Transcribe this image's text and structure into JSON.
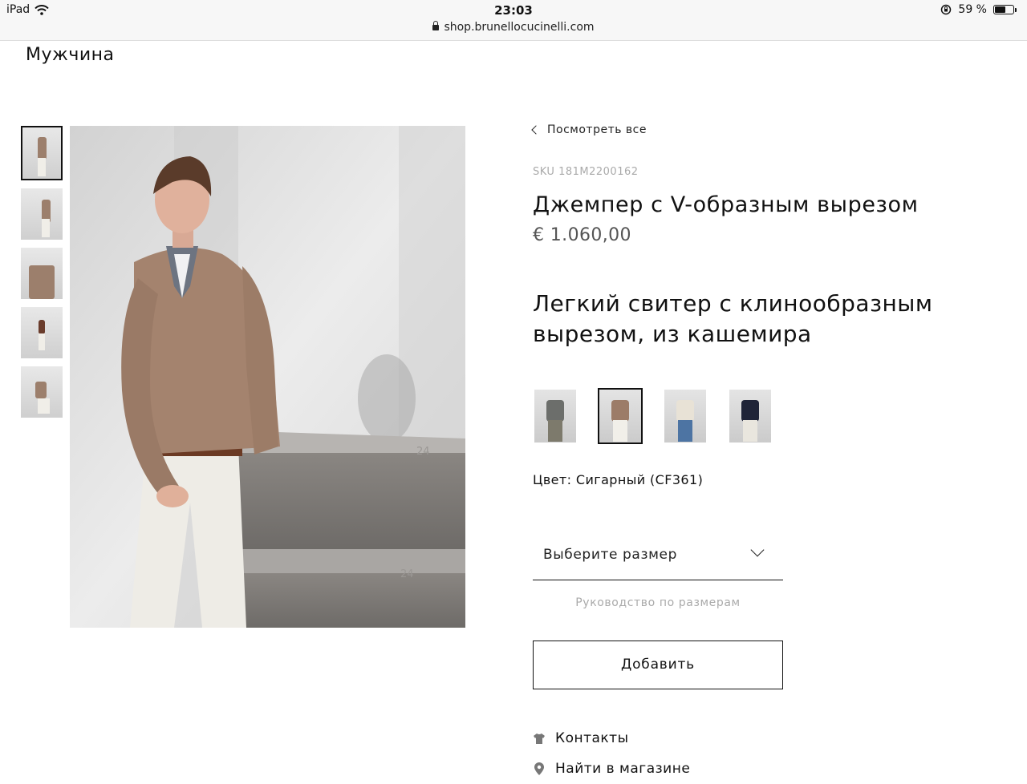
{
  "status_bar": {
    "device": "iPad",
    "time": "23:03",
    "battery": "59 %"
  },
  "url_bar": {
    "url": "shop.brunellocucinelli.com"
  },
  "header": {
    "section": "Мужчина"
  },
  "gallery": {
    "thumbnails_count": 5,
    "selected_index": 0
  },
  "product": {
    "back_label": "Посмотреть все",
    "sku": "SKU 181M2200162",
    "title": "Джемпер с V-образным вырезом",
    "price": "€ 1.060,00",
    "description": "Легкий свитер с клинообразным вырезом, из кашемира",
    "color_label": "Цвет: Сигарный (CF361)",
    "color_variants": [
      {
        "sweater_color": "#6c6e6b",
        "pants_color": "#7d7a6c",
        "selected": false
      },
      {
        "sweater_color": "#9c7c68",
        "pants_color": "#f1efe9",
        "selected": true
      },
      {
        "sweater_color": "#e8e2d6",
        "pants_color": "#4d74a3",
        "selected": false
      },
      {
        "sweater_color": "#1f2438",
        "pants_color": "#e9e6de",
        "selected": false
      }
    ]
  },
  "size": {
    "placeholder": "Выберите размер",
    "guide_label": "Руководство по размерам"
  },
  "actions": {
    "add_label": "Добавить"
  },
  "links": {
    "contacts": "Контакты",
    "find_store": "Найти в магазине"
  }
}
